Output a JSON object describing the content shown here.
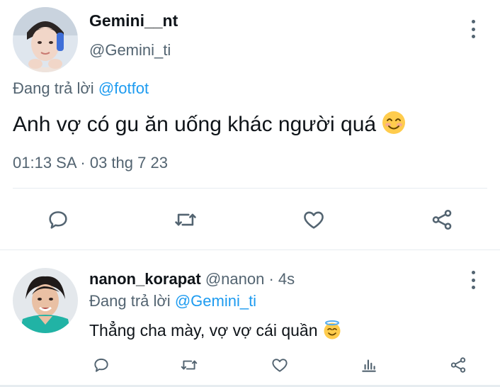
{
  "main_tweet": {
    "display_name": "Gemini__nt",
    "handle": "@Gemini_ti",
    "reply_prefix": "Đang trả lời ",
    "reply_to": "@fotfot",
    "text": "Anh vợ có gu ăn uống khác người quá ",
    "text_emoji": "smiling-face-emoji",
    "timestamp": "01:13 SA · 03 thg 7 23",
    "actions": [
      "reply-icon",
      "retweet-icon",
      "like-icon",
      "share-icon"
    ]
  },
  "reply_tweet": {
    "display_name": "nanon_korapat",
    "handle": " @nanon · 4s",
    "reply_prefix": "Đang trả lời ",
    "reply_to": "@Gemini_ti",
    "text": "Thẳng cha mày, vợ vợ cái quần ",
    "text_emoji": "halo-face-emoji",
    "actions": [
      "reply-icon",
      "retweet-icon",
      "like-icon",
      "views-icon",
      "share-icon"
    ]
  },
  "colors": {
    "text_primary": "#0f1419",
    "text_secondary": "#536471",
    "link": "#1d9bf0",
    "icon": "#536471",
    "divider": "#e6ecf0"
  }
}
